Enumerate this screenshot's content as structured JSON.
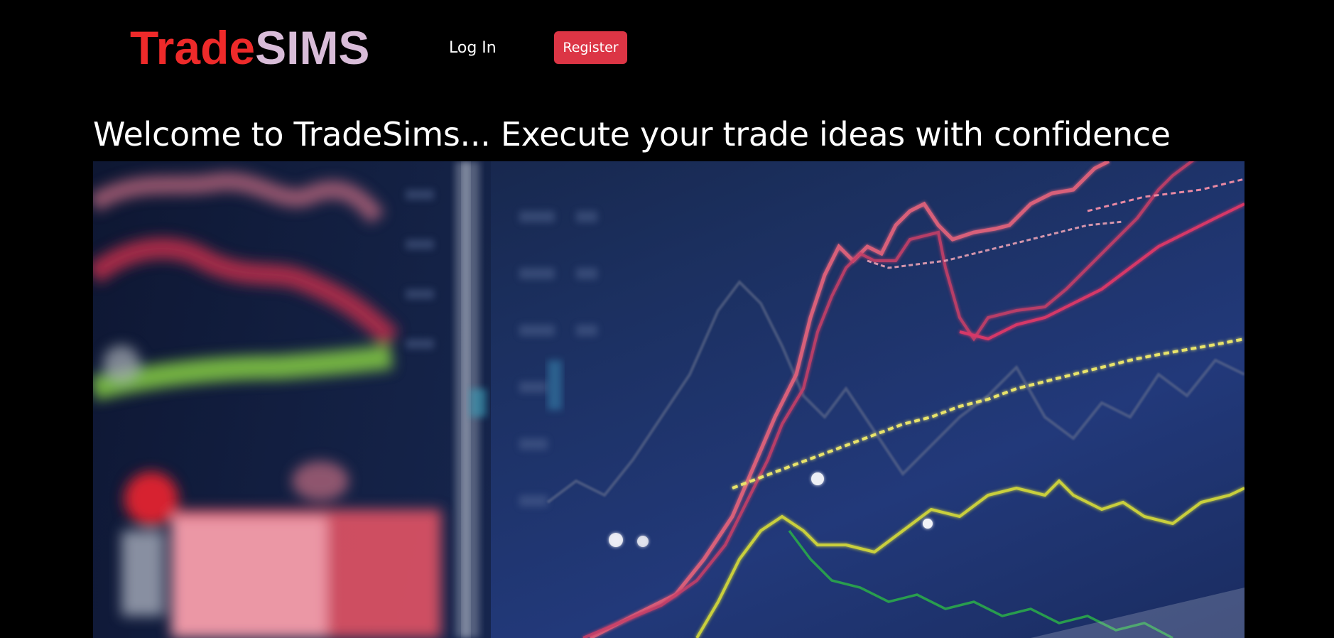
{
  "navbar": {
    "brand_part1": "Trade",
    "brand_part2": "SIMS",
    "login_label": "Log In",
    "register_label": "Register"
  },
  "main": {
    "headline": "Welcome to TradeSims... Execute your trade ideas with confidence"
  },
  "colors": {
    "background": "#000000",
    "brand_red": "#ee2a2a",
    "brand_pink": "#d8bcd8",
    "register_button": "#dc3545"
  }
}
